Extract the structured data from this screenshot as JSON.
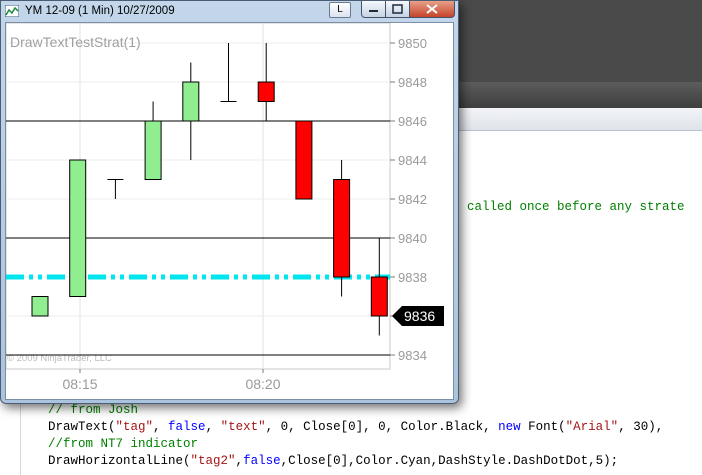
{
  "window": {
    "title": "YM 12-09 (1 Min)  10/27/2009",
    "l_button": "L"
  },
  "chart": {
    "strategy_label": "DrawTextTestStrat(1)",
    "watermark": "© 2009 NinjaTrader, LLC",
    "price_marker": "9836"
  },
  "chart_data": {
    "type": "candlestick",
    "y_ticks": [
      "9850",
      "9848",
      "9846",
      "9844",
      "9842",
      "9840",
      "9838",
      "9836",
      "9834"
    ],
    "x_ticks": [
      "08:15",
      "08:20"
    ],
    "ylim": [
      9833,
      9851
    ],
    "horizontal_lines": [
      {
        "value": 9846,
        "style": "solid",
        "color": "#000000"
      },
      {
        "value": 9840,
        "style": "solid",
        "color": "#000000"
      },
      {
        "value": 9834,
        "style": "solid",
        "color": "#000000"
      },
      {
        "value": 9838,
        "style": "dash-dot-dot",
        "color": "#00e5ee"
      }
    ],
    "bars": [
      {
        "open": 9836,
        "high": 9837,
        "low": 9836,
        "close": 9837
      },
      {
        "open": 9837,
        "high": 9844,
        "low": 9837,
        "close": 9844
      },
      {
        "open": 9843,
        "high": 9843,
        "low": 9842,
        "close": 9843
      },
      {
        "open": 9843,
        "high": 9847,
        "low": 9843,
        "close": 9846
      },
      {
        "open": 9846,
        "high": 9849,
        "low": 9844,
        "close": 9848
      },
      {
        "open": 9847,
        "high": 9850,
        "low": 9847,
        "close": 9847
      },
      {
        "open": 9848,
        "high": 9850,
        "low": 9846,
        "close": 9847
      },
      {
        "open": 9846,
        "high": 9846,
        "low": 9842,
        "close": 9842
      },
      {
        "open": 9843,
        "high": 9844,
        "low": 9837,
        "close": 9838
      },
      {
        "open": 9838,
        "high": 9840,
        "low": 9835,
        "close": 9836
      }
    ],
    "up_color": "#90ee90",
    "down_color": "#ff0000"
  },
  "editor": {
    "comment_fragment": "s called once before any strate",
    "line_comment1": "// from Josh",
    "line_code1_a": "DrawText(",
    "line_code1_tag": "\"tag\"",
    "line_code1_b": ", ",
    "line_code1_false": "false",
    "line_code1_c": ", ",
    "line_code1_text": "\"text\"",
    "line_code1_d": ", 0, Close[0], 0, Color.Black, ",
    "line_code1_new": "new",
    "line_code1_e": " Font(",
    "line_code1_arial": "\"Arial\"",
    "line_code1_f": ", 30),",
    "line_comment2": "//from NT7 indicator",
    "line_code2_a": "DrawHorizontalLine(",
    "line_code2_tag": "\"tag2\"",
    "line_code2_b": ",",
    "line_code2_false": "false",
    "line_code2_c": ",Close[0],Color.Cyan,DashStyle.DashDotDot,5);"
  }
}
